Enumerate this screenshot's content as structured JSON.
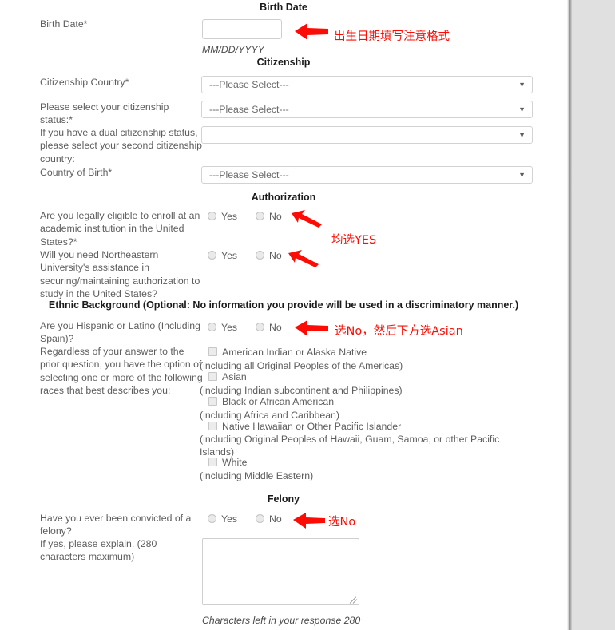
{
  "sections": {
    "birth_date": "Birth Date",
    "citizenship": "Citizenship",
    "authorization": "Authorization",
    "ethnic": "Ethnic Background (Optional: No information you provide will be used in a discriminatory manner.)",
    "felony": "Felony"
  },
  "birth_date": {
    "label": "Birth Date*",
    "value": "",
    "format_hint": "MM/DD/YYYY"
  },
  "citizenship": {
    "country_label": "Citizenship Country*",
    "country_value": "---Please Select---",
    "status_label": "Please select your citizenship status:*",
    "status_value": "---Please Select---",
    "dual_label": "If you have a dual citizenship status, please select your second citizenship country:",
    "dual_value": "",
    "birth_country_label": "Country of Birth*",
    "birth_country_value": "---Please Select---",
    "placeholder": "---Please Select---"
  },
  "authorization": {
    "q1_label": "Are you legally eligible to enroll at an academic institution in the United States?*",
    "q2_label": "Will you need Northeastern University's assistance in securing/maintaining authorization to study in the United States?",
    "yes": "Yes",
    "no": "No"
  },
  "ethnic": {
    "hispanic_label": "Are you Hispanic or Latino (Including Spain)?",
    "yes": "Yes",
    "no": "No",
    "races_label": "Regardless of your answer to the prior question, you have the option of selecting one or more of the following races that best describes you:",
    "races": [
      {
        "label": "American Indian or Alaska Native",
        "note": "(including all Original Peoples of the Americas)",
        "checked": false
      },
      {
        "label": "Asian",
        "note": "(including Indian subcontinent and Philippines)",
        "checked": false
      },
      {
        "label": "Black or African American",
        "note": "(including Africa and Caribbean)",
        "checked": false
      },
      {
        "label": "Native Hawaiian or Other Pacific Islander",
        "note": "(including Original Peoples of Hawaii, Guam, Samoa, or other Pacific Islands)",
        "checked": false
      },
      {
        "label": "White",
        "note": "(including Middle Eastern)",
        "checked": false
      }
    ]
  },
  "felony": {
    "q_label": "Have you ever been convicted of a felony?",
    "yes": "Yes",
    "no": "No",
    "explain_label": "If yes, please explain. (280 characters maximum)",
    "explain_value": "",
    "counter": "Characters left in your response 280"
  },
  "annotations": {
    "color": "#fb0d06",
    "birth_date": "出生日期填写注意格式",
    "authorization": "均选YES",
    "ethnic": "选No，然后下方选Asian",
    "felony": "选No"
  }
}
